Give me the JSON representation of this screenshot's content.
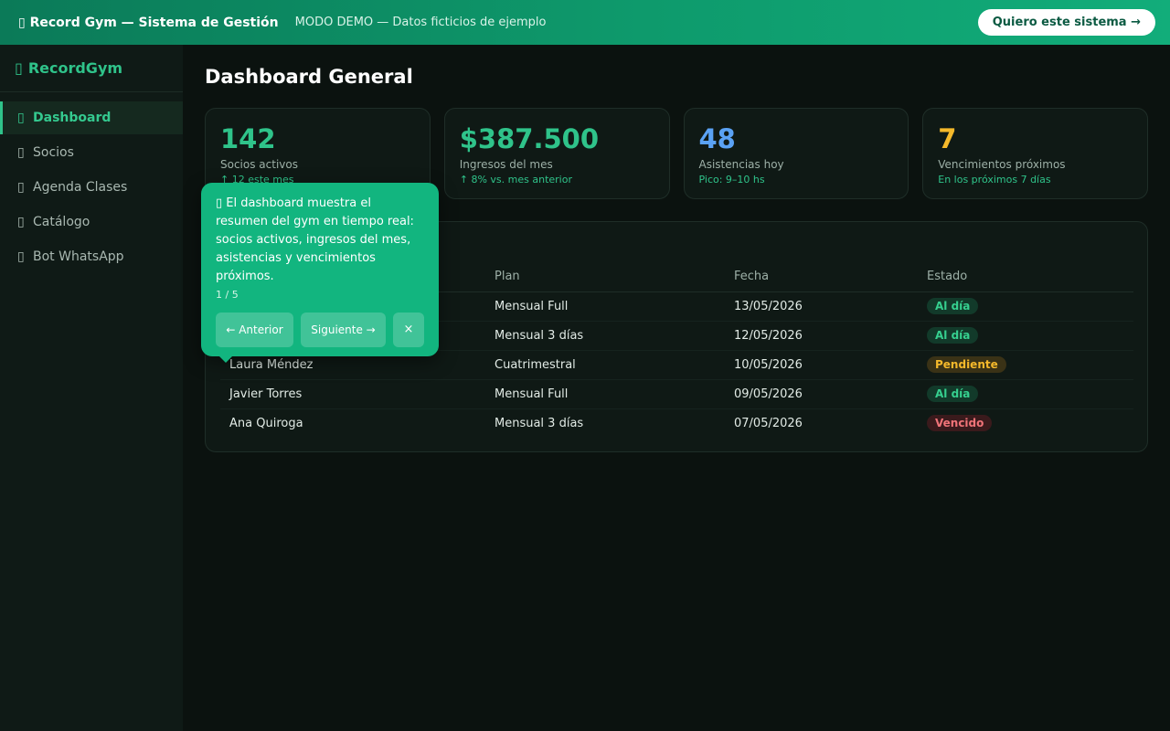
{
  "topbar": {
    "icon": "dumbbell-icon",
    "title": "Record Gym — Sistema de Gestión",
    "demo_notice": "MODO DEMO — Datos ficticios de ejemplo",
    "cta_label": "Quiero este sistema →"
  },
  "sidebar": {
    "brand": "RecordGym",
    "brand_icon": "dumbbell-icon",
    "items": [
      {
        "label": "Dashboard",
        "icon": "dashboard-icon",
        "active": true
      },
      {
        "label": "Socios",
        "icon": "users-icon"
      },
      {
        "label": "Agenda Clases",
        "icon": "calendar-icon"
      },
      {
        "label": "Catálogo",
        "icon": "catalog-icon"
      },
      {
        "label": "Bot WhatsApp",
        "icon": "chat-icon"
      }
    ]
  },
  "main": {
    "title": "Dashboard General",
    "stats": [
      {
        "value": "142",
        "label": "Socios activos",
        "sub": "↑ 12 este mes",
        "color": "#2fc38a"
      },
      {
        "value": "$387.500",
        "label": "Ingresos del mes",
        "sub": "↑ 8% vs. mes anterior",
        "color": "#2fc38a"
      },
      {
        "value": "48",
        "label": "Asistencias hoy",
        "sub": "Pico: 9–10 hs",
        "color": "#5aa2f5"
      },
      {
        "value": "7",
        "label": "Vencimientos próximos",
        "sub": "En los próximos 7 días",
        "color": "#f5b92b"
      }
    ],
    "table": {
      "headers": [
        "",
        "Plan",
        "Fecha",
        "Estado"
      ],
      "rows": [
        {
          "name": "",
          "plan": "Mensual Full",
          "date": "13/05/2026",
          "status": "Al día",
          "kind": "ok"
        },
        {
          "name": "",
          "plan": "Mensual 3 días",
          "date": "12/05/2026",
          "status": "Al día",
          "kind": "ok"
        },
        {
          "name": "Laura Méndez",
          "plan": "Cuatrimestral",
          "date": "10/05/2026",
          "status": "Pendiente",
          "kind": "pend"
        },
        {
          "name": "Javier Torres",
          "plan": "Mensual Full",
          "date": "09/05/2026",
          "status": "Al día",
          "kind": "ok"
        },
        {
          "name": "Ana Quiroga",
          "plan": "Mensual 3 días",
          "date": "07/05/2026",
          "status": "Vencido",
          "kind": "venc"
        }
      ]
    }
  },
  "tour": {
    "icon": "chart-icon",
    "message": "El dashboard muestra el resumen del gym en tiempo real: socios activos, ingresos del mes, asistencias y vencimientos próximos.",
    "step": "1 / 5",
    "prev_label": "← Anterior",
    "next_label": "Siguiente →",
    "close_label": "×"
  },
  "colors": {
    "accent": "#2fc38a",
    "topbar_start": "#0b7a58",
    "topbar_end": "#12ad7a",
    "tour_bg": "#12b57f",
    "status_ok": "#36d08f",
    "status_pending": "#f5b92b",
    "status_expired": "#f07378"
  }
}
